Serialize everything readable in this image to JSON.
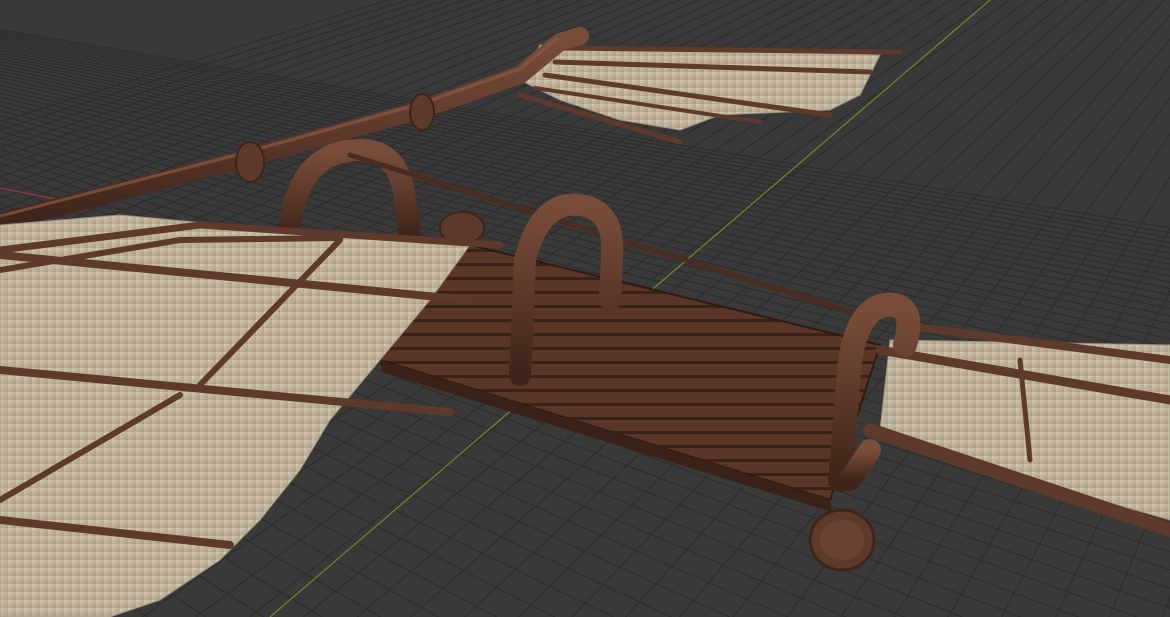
{
  "viewport": {
    "background_color": "#393939",
    "grid_line_color": "#2c2c2c",
    "x_axis_color": "#8b3a3a",
    "y_axis_color": "#6b8a2a"
  },
  "scene": {
    "wood_color": "#5e3a2c",
    "wood_highlight_color": "#7a4d3b",
    "wood_shadow_color": "#3e2419",
    "deck_plank_color": "#5a3628",
    "sail_cloth_color": "#c9bba4",
    "sail_cloth_shadow_color": "#a89a84"
  }
}
